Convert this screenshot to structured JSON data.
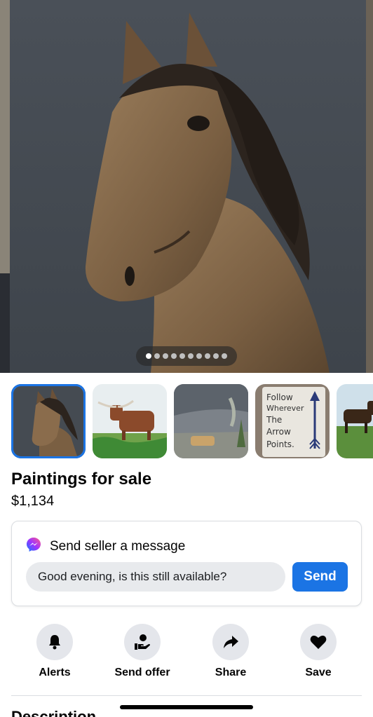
{
  "listing": {
    "title": "Paintings for sale",
    "price": "$1,134"
  },
  "gallery": {
    "photo_count": 10,
    "active_index": 0,
    "thumbnails": [
      {
        "name": "horse-painting"
      },
      {
        "name": "longhorn-painting"
      },
      {
        "name": "storm-landscape-painting"
      },
      {
        "name": "arrow-quote-painting",
        "text": [
          "Follow",
          "Wherever",
          "The",
          "Arrow",
          "Points."
        ]
      },
      {
        "name": "horse-field-painting"
      }
    ]
  },
  "message_card": {
    "header": "Send seller a message",
    "input_value": "Good evening, is this still available?",
    "send_label": "Send",
    "icon": "messenger-icon"
  },
  "actions": [
    {
      "label": "Alerts",
      "icon": "bell-icon"
    },
    {
      "label": "Send offer",
      "icon": "offer-icon"
    },
    {
      "label": "Share",
      "icon": "share-arrow-icon"
    },
    {
      "label": "Save",
      "icon": "heart-icon"
    }
  ],
  "section_heading": "Description",
  "colors": {
    "accent": "#1b74e4",
    "action_circle": "#e4e6eb",
    "input_bg": "#e8eaed"
  }
}
